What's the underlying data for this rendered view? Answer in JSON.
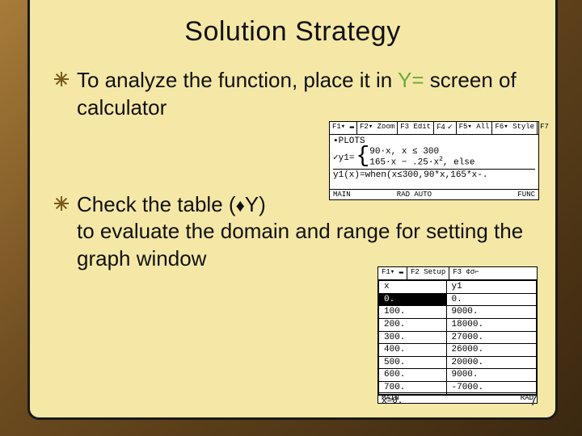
{
  "slide": {
    "title": "Solution Strategy",
    "page_number": "7"
  },
  "bullets": {
    "b1_pre": "To analyze the function, place it in ",
    "b1_yeq": "Y=",
    "b1_post": " screen of calculator",
    "b2_pre": "Check the table (",
    "b2_diamond": "♦",
    "b2_y": "Y)",
    "b2_post": " to evaluate the domain and range for setting the graph window"
  },
  "calc1": {
    "menu": {
      "f1": "F1▾ ▬",
      "f2": "F2▾ Zoom",
      "f3": "F3 Edit",
      "f4": "F4 ✓",
      "f5": "F5▾ All",
      "f6": "F6▾ Style",
      "f7": "F7"
    },
    "plots_label": "▪PLOTS",
    "yline_label": "✓y1=",
    "piecewise": {
      "line1": "90·x, x ≤ 300",
      "line2_a": "165·x − .25·x",
      "line2_exp": "2",
      "line2_b": ", else"
    },
    "entry": "y1(x)=when(x≤300,90*x,165*x-.",
    "status_left": "MAIN",
    "status_mid": "RAD AUTO",
    "status_right": "FUNC"
  },
  "calc2": {
    "menu": {
      "f1": "F1▾ ▬",
      "f2": "F2 Setup",
      "f3": "F3 ¢σ⌐"
    },
    "headers": {
      "x": "x",
      "y1": "y1"
    },
    "rows": [
      {
        "x": "0.",
        "y1": "0."
      },
      {
        "x": "100.",
        "y1": "9000."
      },
      {
        "x": "200.",
        "y1": "18000."
      },
      {
        "x": "300.",
        "y1": "27000."
      },
      {
        "x": "400.",
        "y1": "26000."
      },
      {
        "x": "500.",
        "y1": "20000."
      },
      {
        "x": "600.",
        "y1": "9000."
      },
      {
        "x": "700.",
        "y1": "-7000."
      }
    ],
    "entry": "x=0.",
    "status_left": "MAIN",
    "status_right": "RAD"
  }
}
